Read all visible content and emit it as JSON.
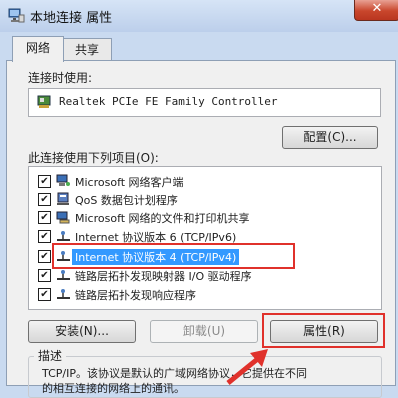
{
  "window": {
    "title": "本地连接 属性",
    "close": "✕"
  },
  "tabs": [
    {
      "label": "网络"
    },
    {
      "label": "共享"
    }
  ],
  "connect_using": {
    "label": "连接时使用:",
    "adapter": "Realtek PCIe FE Family Controller",
    "configure_button": "配置(C)..."
  },
  "items_label": "此连接使用下列项目(O):",
  "items": [
    {
      "label": "Microsoft 网络客户端",
      "icon": "network-client-icon",
      "checked": true
    },
    {
      "label": "QoS 数据包计划程序",
      "icon": "qos-icon",
      "checked": true
    },
    {
      "label": "Microsoft 网络的文件和打印机共享",
      "icon": "file-print-share-icon",
      "checked": true
    },
    {
      "label": "Internet 协议版本 6 (TCP/IPv6)",
      "icon": "protocol-icon",
      "checked": true
    },
    {
      "label": "Internet 协议版本 4 (TCP/IPv4)",
      "icon": "protocol-icon",
      "checked": true
    },
    {
      "label": "链路层拓扑发现映射器 I/O 驱动程序",
      "icon": "protocol-icon",
      "checked": true
    },
    {
      "label": "链路层拓扑发现响应程序",
      "icon": "protocol-icon",
      "checked": true
    }
  ],
  "buttons": {
    "install": "安装(N)...",
    "uninstall": "卸载(U)",
    "properties": "属性(R)"
  },
  "description": {
    "title": "描述",
    "text1": "TCP/IP。该协议是默认的广域网络协议，它提供在不同",
    "text2": "的相互连接的网络上的通讯。"
  },
  "colors": {
    "highlight": "#e0312b",
    "selection": "#3399ff"
  }
}
